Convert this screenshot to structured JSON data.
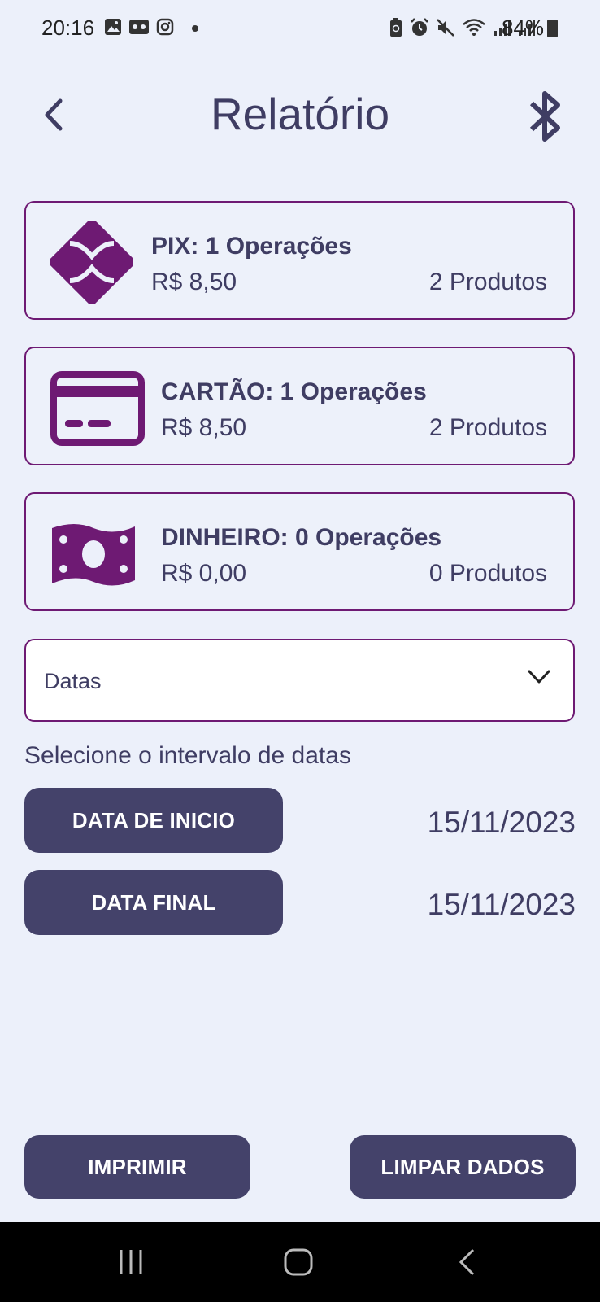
{
  "status_bar": {
    "time": "20:16",
    "battery": "84%",
    "left_icons": [
      "gallery-icon",
      "voicemail-icon",
      "instagram-icon"
    ],
    "right_icons": [
      "battery-saver-icon",
      "alarm-icon",
      "mute-icon",
      "wifi-icon",
      "signal-icon",
      "signal-icon"
    ]
  },
  "header": {
    "title": "Relatório",
    "back_icon": "chevron-left-icon",
    "action_icon": "bluetooth-icon"
  },
  "payments": [
    {
      "icon": "pix-icon",
      "title": "PIX: 1 Operações",
      "amount": "R$ 8,50",
      "products": "2 Produtos"
    },
    {
      "icon": "credit-card-icon",
      "title": "CARTÃO: 1 Operações",
      "amount": "R$ 8,50",
      "products": "2 Produtos"
    },
    {
      "icon": "cash-icon",
      "title": "DINHEIRO: 0 Operações",
      "amount": "R$ 0,00",
      "products": "0 Produtos"
    }
  ],
  "filter": {
    "dropdown_value": "Datas",
    "range_label": "Selecione o intervalo de datas",
    "start_button": "DATA DE INICIO",
    "start_date": "15/11/2023",
    "end_button": "DATA FINAL",
    "end_date": "15/11/2023"
  },
  "actions": {
    "print": "IMPRIMIR",
    "clear": "LIMPAR DADOS"
  },
  "colors": {
    "background": "#ECF0FA",
    "primary": "#44426A",
    "text": "#3F3D63",
    "accent": "#6E1A73"
  },
  "nav_bar": {
    "icons": [
      "recent-apps-icon",
      "home-icon",
      "nav-back-icon"
    ]
  }
}
